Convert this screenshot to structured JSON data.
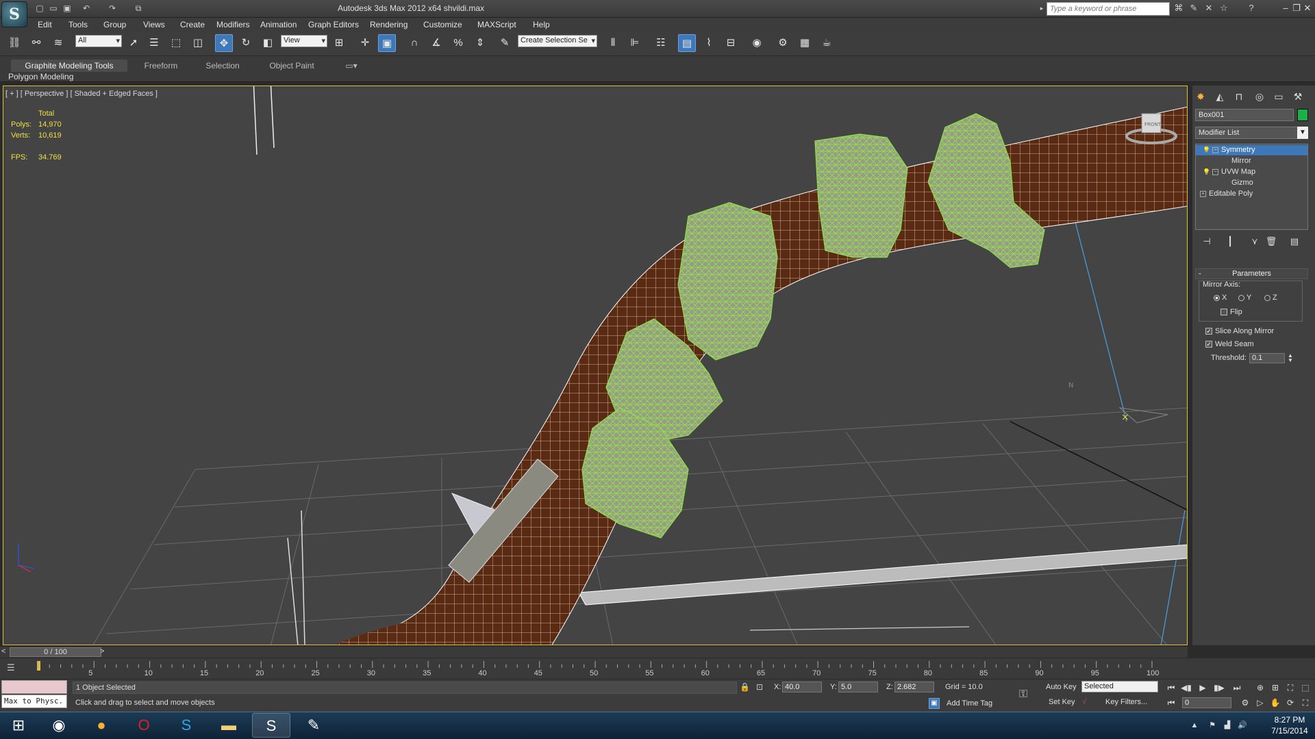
{
  "title_bar": {
    "app_logo": "S",
    "title": "Autodesk 3ds Max  2012 x64      shvildi.max",
    "search_placeholder": "Type a keyword or phrase"
  },
  "menu": {
    "items": [
      "Edit",
      "Tools",
      "Group",
      "Views",
      "Create",
      "Modifiers",
      "Animation",
      "Graph Editors",
      "Rendering",
      "Customize",
      "MAXScript",
      "Help"
    ]
  },
  "toolbar": {
    "selection_filter": "All",
    "ref_coord": "View",
    "named_selection": "Create Selection Se"
  },
  "ribbon": {
    "tabs": [
      "Graphite Modeling Tools",
      "Freeform",
      "Selection",
      "Object Paint"
    ],
    "sub_label": "Polygon Modeling"
  },
  "viewport": {
    "label": "[ + ] [ Perspective ] [ Shaded + Edged Faces ]",
    "stats": {
      "total_label": "Total",
      "polys_label": "Polys:",
      "polys_value": "14,970",
      "verts_label": "Verts:",
      "verts_value": "10,619",
      "fps_label": "FPS:",
      "fps_value": "34.769"
    },
    "viewcube_label": "FRONT",
    "compass_n": "N"
  },
  "command_panel": {
    "object_name": "Box001",
    "object_color": "#1cb049",
    "modifier_list": "Modifier List",
    "stack": [
      {
        "label": "Symmetry",
        "level": 0,
        "selected": true
      },
      {
        "label": "Mirror",
        "level": 1,
        "selected": false
      },
      {
        "label": "UVW Map",
        "level": 0,
        "selected": false
      },
      {
        "label": "Gizmo",
        "level": 1,
        "selected": false
      },
      {
        "label": "Editable Poly",
        "level": 0,
        "selected": false
      }
    ],
    "params_title": "Parameters",
    "mirror_axis_label": "Mirror Axis:",
    "axis_x": "X",
    "axis_y": "Y",
    "axis_z": "Z",
    "flip_label": "Flip",
    "slice_label": "Slice Along Mirror",
    "weld_label": "Weld Seam",
    "threshold_label": "Threshold:",
    "threshold_value": "0.1"
  },
  "timeline": {
    "frame_display": "0 / 100",
    "prev": "<",
    "next": ">",
    "ticks": [
      "5",
      "10",
      "15",
      "20",
      "25",
      "30",
      "35",
      "40",
      "45",
      "50",
      "55",
      "60",
      "65",
      "70",
      "75",
      "80",
      "85",
      "90",
      "95",
      "100"
    ]
  },
  "status": {
    "maxscript": "Max to Physc.",
    "selected": "1 Object Selected",
    "prompt": "Click and drag to select and move objects",
    "x_label": "X:",
    "x_value": "40.0",
    "y_label": "Y:",
    "y_value": "5.0",
    "z_label": "Z:",
    "z_value": "2.682",
    "grid": "Grid = 10.0",
    "add_time_tag": "Add Time Tag",
    "auto_key": "Auto Key",
    "set_key": "Set Key",
    "key_mode": "Selected",
    "key_filters": "Key Filters...",
    "current_frame": "0"
  },
  "taskbar": {
    "time": "8:27 PM",
    "date": "7/15/2014"
  }
}
